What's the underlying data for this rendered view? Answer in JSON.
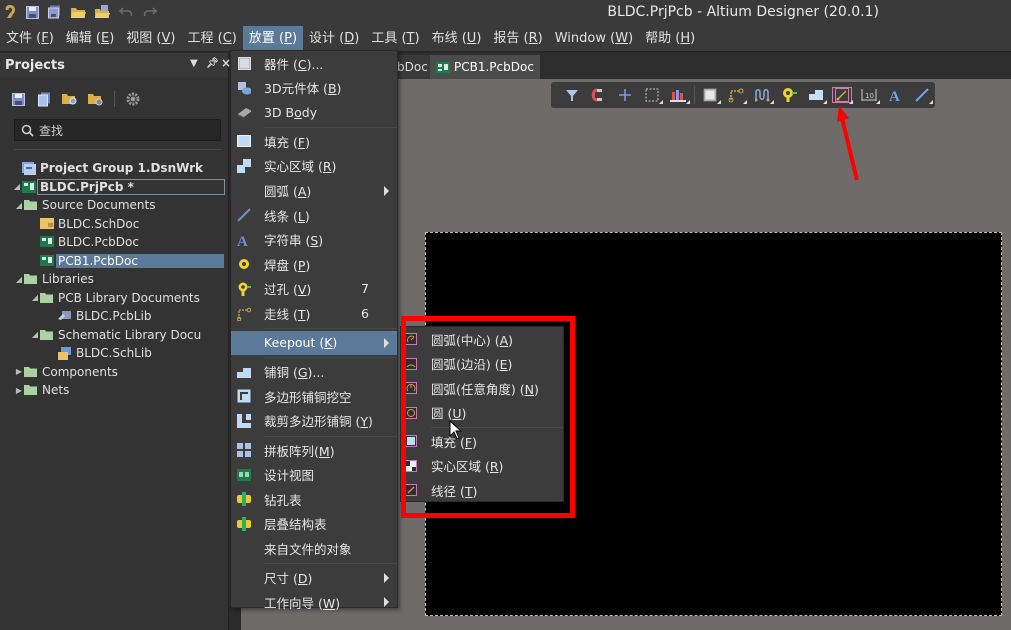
{
  "window": {
    "title": "BLDC.PrjPcb - Altium Designer (20.0.1)"
  },
  "quick_access": [
    "app-logo-icon",
    "save-icon",
    "save-all-icon",
    "open-folder-icon",
    "open-project-icon",
    "undo-icon",
    "redo-icon"
  ],
  "menubar": {
    "items": [
      {
        "label": "文件 (",
        "key": "F",
        "end": ")"
      },
      {
        "label": "编辑 (",
        "key": "E",
        "end": ")"
      },
      {
        "label": "视图 (",
        "key": "V",
        "end": ")"
      },
      {
        "label": "工程 (",
        "key": "C",
        "end": ")"
      },
      {
        "label": "放置 (",
        "key": "P",
        "end": ")",
        "active": true
      },
      {
        "label": "设计 (",
        "key": "D",
        "end": ")"
      },
      {
        "label": "工具 (",
        "key": "T",
        "end": ")"
      },
      {
        "label": "布线 (",
        "key": "U",
        "end": ")"
      },
      {
        "label": "报告 (",
        "key": "R",
        "end": ")"
      },
      {
        "label": "Window (",
        "key": "W",
        "end": ")"
      },
      {
        "label": "帮助 (",
        "key": "H",
        "end": ")"
      }
    ]
  },
  "projects_panel": {
    "title": "Projects",
    "controls": [
      "▾",
      "⊥",
      "×"
    ],
    "toolbar": [
      "save-project-icon",
      "copy-icon",
      "find-folder-icon",
      "folder-settings-icon",
      "gear-icon"
    ],
    "search_placeholder": "查找",
    "tree": [
      {
        "label": "Project Group 1.DsnWrk",
        "level": 0,
        "bold": true,
        "icon": "workspace"
      },
      {
        "label": "BLDC.PrjPcb *",
        "level": 0,
        "bold": true,
        "icon": "pcb-project",
        "arrow": "open",
        "focused": true
      },
      {
        "label": "Source Documents",
        "level": 1,
        "icon": "folder",
        "arrow": "open"
      },
      {
        "label": "BLDC.SchDoc",
        "level": 2,
        "icon": "schdoc"
      },
      {
        "label": "BLDC.PcbDoc",
        "level": 2,
        "icon": "pcbdoc"
      },
      {
        "label": "PCB1.PcbDoc",
        "level": 2,
        "icon": "pcbdoc",
        "selected": true
      },
      {
        "label": "Libraries",
        "level": 1,
        "icon": "folder",
        "arrow": "open"
      },
      {
        "label": "PCB Library Documents",
        "level": 2,
        "icon": "folder",
        "arrow": "open"
      },
      {
        "label": "BLDC.PcbLib",
        "level": 3,
        "icon": "pcblib"
      },
      {
        "label": "Schematic Library Docu",
        "level": 2,
        "icon": "folder",
        "arrow": "open"
      },
      {
        "label": "BLDC.SchLib",
        "level": 3,
        "icon": "schlib"
      },
      {
        "label": "Components",
        "level": 1,
        "icon": "folder",
        "arrow": "closed"
      },
      {
        "label": "Nets",
        "level": 1,
        "icon": "folder",
        "arrow": "closed"
      }
    ]
  },
  "tabs": [
    {
      "label": "bDoc",
      "active": false
    },
    {
      "label": "PCB1.PcbDoc",
      "active": true
    }
  ],
  "pcb_toolbar": {
    "tools": [
      "filter-icon",
      "snap-magnet-icon",
      "cross-icon",
      "select-rect-icon",
      "align-icon",
      "component-icon",
      "route-icon",
      "diff-pair-icon",
      "via-icon",
      "polygon-icon",
      "keepout-icon",
      "dimension-icon",
      "text-icon",
      "line-icon"
    ],
    "highlighted": "keepout-icon"
  },
  "place_menu": {
    "items": [
      {
        "label": "器件 (",
        "key": "C",
        "end": ")...",
        "icon": "component"
      },
      {
        "label": "3D元件体 (",
        "key": "B",
        "end": ")",
        "icon": "3d-body"
      },
      {
        "label": "3D B",
        "key": "o",
        "end": "dy",
        "icon": "3d-body-chip"
      },
      {
        "sep": true
      },
      {
        "label": "填充 (",
        "key": "F",
        "end": ")",
        "icon": "fill"
      },
      {
        "label": "实心区域 (",
        "key": "R",
        "end": ")",
        "icon": "solid-region"
      },
      {
        "label": "圆弧 (",
        "key": "A",
        "end": ")",
        "icon": "none",
        "submenu": true
      },
      {
        "label": "线条 (",
        "key": "L",
        "end": ")",
        "icon": "line"
      },
      {
        "label": "字符串 (",
        "key": "S",
        "end": ")",
        "icon": "text"
      },
      {
        "label": "焊盘 (",
        "key": "P",
        "end": ")",
        "icon": "pad"
      },
      {
        "label": "过孔 (",
        "key": "V",
        "end": ")",
        "icon": "via",
        "shortcut": "7"
      },
      {
        "label": "走线 (",
        "key": "T",
        "end": ")",
        "icon": "track",
        "shortcut": "6"
      },
      {
        "sep": true
      },
      {
        "label": "Keepout (",
        "key": "K",
        "end": ")",
        "icon": "none",
        "submenu": true,
        "active": true
      },
      {
        "sep": true
      },
      {
        "label": "铺铜 (",
        "key": "G",
        "end": ")...",
        "icon": "polygon"
      },
      {
        "label": "多边形铺铜挖空",
        "key": "",
        "end": "",
        "icon": "cutout"
      },
      {
        "label": "裁剪多边形铺铜 (",
        "key": "Y",
        "end": ")",
        "icon": "slice"
      },
      {
        "sep": true
      },
      {
        "label": "拼板阵列(",
        "key": "M",
        "end": ")",
        "icon": "panel-array"
      },
      {
        "label": "设计视图",
        "key": "",
        "end": "",
        "icon": "design-view"
      },
      {
        "label": "钻孔表",
        "key": "",
        "end": "",
        "icon": "drill-table"
      },
      {
        "label": "层叠结构表",
        "key": "",
        "end": "",
        "icon": "layer-stack-table"
      },
      {
        "label": "来自文件的对象",
        "key": "",
        "end": "",
        "icon": "none"
      },
      {
        "sep": true
      },
      {
        "label": "尺寸 (",
        "key": "D",
        "end": ")",
        "icon": "none",
        "submenu": true
      },
      {
        "label": "工作向导 (",
        "key": "W",
        "end": ")",
        "icon": "none",
        "submenu": true
      }
    ]
  },
  "keepout_menu": {
    "items": [
      {
        "label": "圆弧(中心) (",
        "key": "A",
        "end": ")",
        "icon": "arc-center"
      },
      {
        "label": "圆弧(边沿) (",
        "key": "E",
        "end": ")",
        "icon": "arc-edge"
      },
      {
        "label": "圆弧(任意角度) (",
        "key": "N",
        "end": ")",
        "icon": "arc-any"
      },
      {
        "label": "圆 (",
        "key": "U",
        "end": ")",
        "icon": "circle"
      },
      {
        "sep": true
      },
      {
        "label": "填充 (",
        "key": "F",
        "end": ")",
        "icon": "fill"
      },
      {
        "label": "实心区域 (",
        "key": "R",
        "end": ")",
        "icon": "solid-region"
      },
      {
        "label": "线径 (",
        "key": "T",
        "end": ")",
        "icon": "track"
      }
    ]
  },
  "colors": {
    "accent": "#5b7a9a",
    "annotation": "#ff0000",
    "board": "#000000",
    "workspace": "#6e6b69"
  }
}
